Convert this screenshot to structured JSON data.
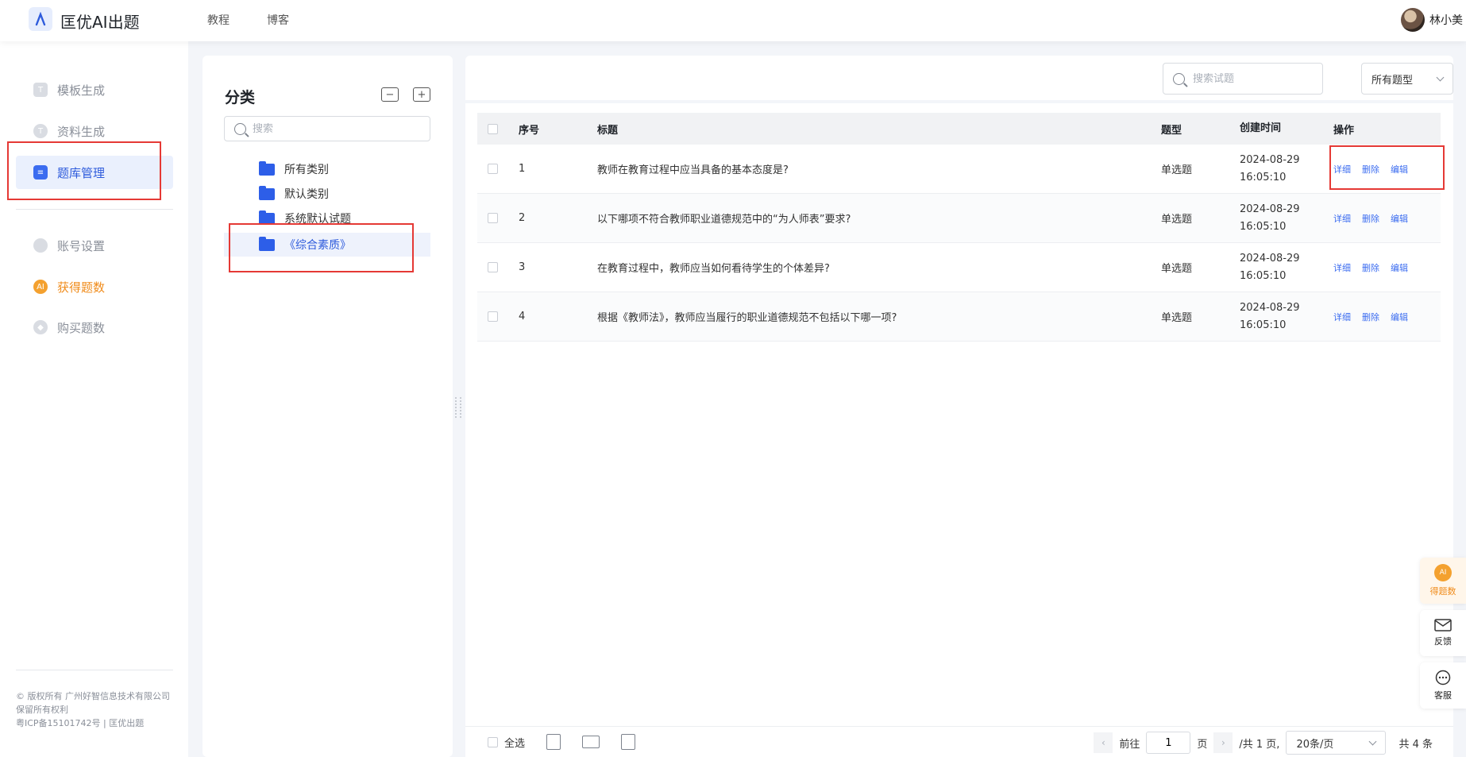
{
  "header": {
    "app_title": "匡优AI出题",
    "nav": [
      "教程",
      "博客"
    ],
    "user_name": "林小美"
  },
  "sidebar": {
    "items": [
      {
        "label": "模板生成",
        "icon": "template-icon",
        "active": false
      },
      {
        "label": "资料生成",
        "icon": "document-icon",
        "active": false
      },
      {
        "label": "题库管理",
        "icon": "question-bank-icon",
        "active": true
      },
      {
        "label": "账号设置",
        "icon": "user-icon",
        "active": false
      },
      {
        "label": "获得题数",
        "icon": "ai-badge-icon",
        "active": false,
        "accent": "#f08c1c"
      },
      {
        "label": "购买题数",
        "icon": "diamond-icon",
        "active": false
      }
    ],
    "copyright": "© 版权所有 广州好智信息技术有限公司",
    "rights": "保留所有权利",
    "icp": "粤ICP备15101742号 | 匡优出题"
  },
  "category": {
    "title": "分类",
    "search_placeholder": "搜索",
    "items": [
      {
        "label": "所有类别",
        "selected": false
      },
      {
        "label": "默认类别",
        "selected": false
      },
      {
        "label": "系统默认试题",
        "selected": false
      },
      {
        "label": "《综合素质》",
        "selected": true
      }
    ]
  },
  "main": {
    "search_placeholder": "搜索试题",
    "type_filter": "所有题型",
    "columns": [
      "序号",
      "标题",
      "题型",
      "创建时间",
      "操作"
    ],
    "rows": [
      {
        "idx": "1",
        "title": "教师在教育过程中应当具备的基本态度是?",
        "type": "单选题",
        "date": "2024-08-29",
        "time": "16:05:10"
      },
      {
        "idx": "2",
        "title": "以下哪项不符合教师职业道德规范中的“为人师表”要求?",
        "type": "单选题",
        "date": "2024-08-29",
        "time": "16:05:10"
      },
      {
        "idx": "3",
        "title": "在教育过程中，教师应当如何看待学生的个体差异?",
        "type": "单选题",
        "date": "2024-08-29",
        "time": "16:05:10"
      },
      {
        "idx": "4",
        "title": "根据《教师法》，教师应当履行的职业道德规范不包括以下哪一项?",
        "type": "单选题",
        "date": "2024-08-29",
        "time": "16:05:10"
      }
    ],
    "ops": [
      "详细",
      "删除",
      "编辑"
    ]
  },
  "footer": {
    "select_all": "全选",
    "goto": "前往",
    "page_value": "1",
    "page_unit": "页",
    "total_pages": "/共 1 页,",
    "page_size": "20条/页",
    "total": "共 4 条"
  },
  "float": {
    "ai_label": "得题数",
    "ai_badge": "AI",
    "feedback": "反馈",
    "service": "客服"
  },
  "colors": {
    "accent": "#2e5bdc",
    "link": "#3b6cf0",
    "orange": "#f08c1c",
    "highlight": "#e53935"
  }
}
